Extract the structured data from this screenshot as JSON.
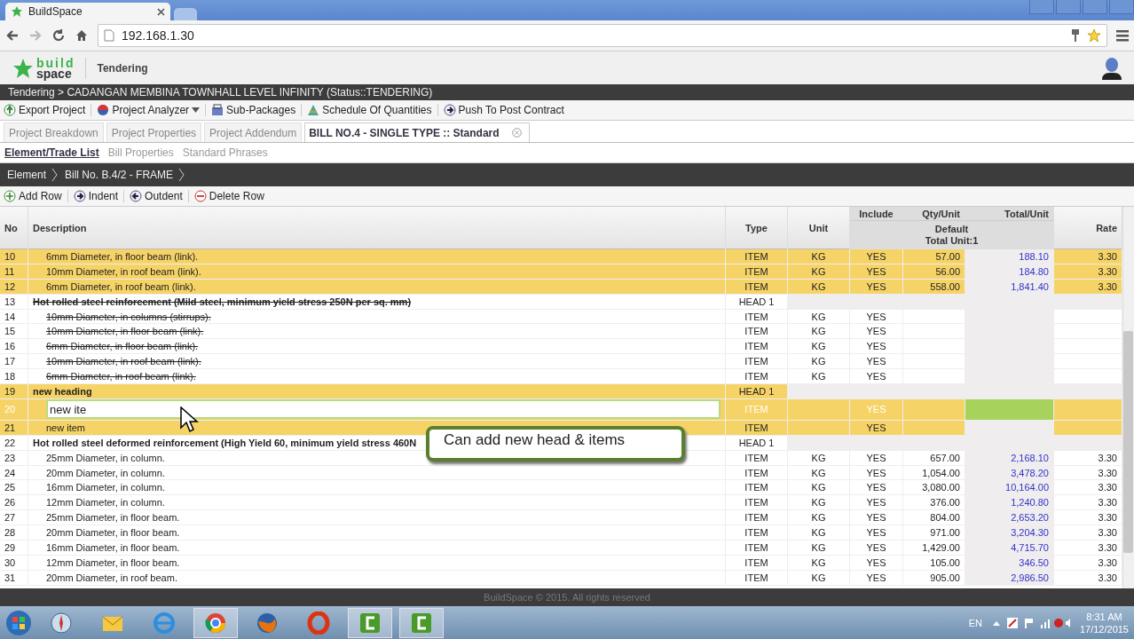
{
  "browser": {
    "tabs": [
      {
        "title": "BuildSpace",
        "selected": true
      },
      {
        "selected": false
      }
    ],
    "address": "192.168.1.30"
  },
  "app": {
    "logo_top": "build",
    "logo_bottom": "space",
    "module": "Tendering"
  },
  "breadcrumb": "Tendering > CADANGAN MEMBINA TOWNHALL LEVEL INFINITY (Status::TENDERING)",
  "toolbar": [
    {
      "label": "Export Project",
      "kind": "button"
    },
    {
      "label": "Project Analyzer",
      "kind": "menu"
    },
    {
      "label": "Sub-Packages",
      "kind": "button"
    },
    {
      "label": "Schedule Of Quantities",
      "kind": "button"
    },
    {
      "label": "Push To Post Contract",
      "kind": "button"
    }
  ],
  "tabs": [
    {
      "label": "Project Breakdown",
      "selected": false,
      "kind": "fixed"
    },
    {
      "label": "Project Properties",
      "selected": false,
      "kind": "fixed"
    },
    {
      "label": "Project Addendum",
      "selected": false,
      "kind": "fixed"
    },
    {
      "label": "BILL NO.4 - SINGLE TYPE :: Standard",
      "selected": true,
      "kind": "closable"
    }
  ],
  "subtabs": [
    {
      "label": "Element/Trade List",
      "selected": true
    },
    {
      "label": "Bill Properties",
      "selected": false
    },
    {
      "label": "Standard Phrases",
      "selected": false
    }
  ],
  "path": [
    "Element",
    "Bill No. B.4/2 - FRAME"
  ],
  "row_actions": [
    {
      "label": "Add Row"
    },
    {
      "label": "Indent"
    },
    {
      "label": "Outdent"
    },
    {
      "label": "Delete Row"
    }
  ],
  "table": {
    "columns": {
      "no": "No",
      "description": "Description",
      "type": "Type",
      "unit": "Unit",
      "include": "Include",
      "qty": "Qty/Unit",
      "total": "Total/Unit",
      "rate": "Rate",
      "group": "Default",
      "group_sub": "Total Unit:1"
    },
    "rows": [
      {
        "no": "10",
        "description": "6mm Diameter, in floor beam (link).",
        "kind": "item",
        "type": "ITEM",
        "unit": "KG",
        "include": "YES",
        "qty": "57.00",
        "total": "188.10",
        "rate": "3.30",
        "selected": true,
        "deleted": false
      },
      {
        "no": "11",
        "description": "10mm Diameter, in roof beam (link).",
        "kind": "item",
        "type": "ITEM",
        "unit": "KG",
        "include": "YES",
        "qty": "56.00",
        "total": "184.80",
        "rate": "3.30",
        "selected": true,
        "deleted": false
      },
      {
        "no": "12",
        "description": "6mm Diameter, in roof beam (link).",
        "kind": "item",
        "type": "ITEM",
        "unit": "KG",
        "include": "YES",
        "qty": "558.00",
        "total": "1,841.40",
        "rate": "3.30",
        "selected": true,
        "deleted": false
      },
      {
        "no": "13",
        "description": "Hot rolled steel reinforcement (Mild steel, minimum yield stress 250N per sq. mm)",
        "kind": "head",
        "type": "HEAD 1",
        "selected": false,
        "deleted": true
      },
      {
        "no": "14",
        "description": "10mm Diameter, in columns (stirrups).",
        "kind": "item",
        "type": "ITEM",
        "unit": "KG",
        "include": "YES",
        "selected": false,
        "deleted": true
      },
      {
        "no": "15",
        "description": "10mm Diameter, in floor beam (link).",
        "kind": "item",
        "type": "ITEM",
        "unit": "KG",
        "include": "YES",
        "selected": false,
        "deleted": true
      },
      {
        "no": "16",
        "description": "6mm Diameter, in floor beam (link).",
        "kind": "item",
        "type": "ITEM",
        "unit": "KG",
        "include": "YES",
        "selected": false,
        "deleted": true
      },
      {
        "no": "17",
        "description": "10mm Diameter, in roof beam (link).",
        "kind": "item",
        "type": "ITEM",
        "unit": "KG",
        "include": "YES",
        "selected": false,
        "deleted": true
      },
      {
        "no": "18",
        "description": "6mm Diameter, in roof beam (link).",
        "kind": "item",
        "type": "ITEM",
        "unit": "KG",
        "include": "YES",
        "selected": false,
        "deleted": true
      },
      {
        "no": "19",
        "description": "new heading",
        "kind": "head",
        "type": "HEAD 1",
        "selected": true,
        "deleted": false
      },
      {
        "no": "20",
        "description": "new ite",
        "kind": "item",
        "type": "ITEM",
        "include": "YES",
        "selected": true,
        "deleted": false,
        "editing": true
      },
      {
        "no": "21",
        "description": "new item",
        "kind": "item",
        "type": "ITEM",
        "include": "YES",
        "selected": true,
        "deleted": false
      },
      {
        "no": "22",
        "description": "Hot rolled steel deformed reinforcement (High Yield 60, minimum yield stress 460N",
        "kind": "head",
        "type": "HEAD 1",
        "selected": false,
        "deleted": false
      },
      {
        "no": "23",
        "description": "25mm Diameter, in column.",
        "kind": "item",
        "type": "ITEM",
        "unit": "KG",
        "include": "YES",
        "qty": "657.00",
        "total": "2,168.10",
        "rate": "3.30",
        "selected": false,
        "deleted": false
      },
      {
        "no": "24",
        "description": "20mm Diameter, in column.",
        "kind": "item",
        "type": "ITEM",
        "unit": "KG",
        "include": "YES",
        "qty": "1,054.00",
        "total": "3,478.20",
        "rate": "3.30",
        "selected": false,
        "deleted": false
      },
      {
        "no": "25",
        "description": "16mm Diameter, in column.",
        "kind": "item",
        "type": "ITEM",
        "unit": "KG",
        "include": "YES",
        "qty": "3,080.00",
        "total": "10,164.00",
        "rate": "3.30",
        "selected": false,
        "deleted": false
      },
      {
        "no": "26",
        "description": "12mm Diameter, in column.",
        "kind": "item",
        "type": "ITEM",
        "unit": "KG",
        "include": "YES",
        "qty": "376.00",
        "total": "1,240.80",
        "rate": "3.30",
        "selected": false,
        "deleted": false
      },
      {
        "no": "27",
        "description": "25mm Diameter, in floor beam.",
        "kind": "item",
        "type": "ITEM",
        "unit": "KG",
        "include": "YES",
        "qty": "804.00",
        "total": "2,653.20",
        "rate": "3.30",
        "selected": false,
        "deleted": false
      },
      {
        "no": "28",
        "description": "20mm Diameter, in floor beam.",
        "kind": "item",
        "type": "ITEM",
        "unit": "KG",
        "include": "YES",
        "qty": "971.00",
        "total": "3,204.30",
        "rate": "3.30",
        "selected": false,
        "deleted": false
      },
      {
        "no": "29",
        "description": "16mm Diameter, in floor beam.",
        "kind": "item",
        "type": "ITEM",
        "unit": "KG",
        "include": "YES",
        "qty": "1,429.00",
        "total": "4,715.70",
        "rate": "3.30",
        "selected": false,
        "deleted": false
      },
      {
        "no": "30",
        "description": "12mm Diameter, in floor beam.",
        "kind": "item",
        "type": "ITEM",
        "unit": "KG",
        "include": "YES",
        "qty": "105.00",
        "total": "346.50",
        "rate": "3.30",
        "selected": false,
        "deleted": false
      },
      {
        "no": "31",
        "description": "20mm Diameter, in roof beam.",
        "kind": "item",
        "type": "ITEM",
        "unit": "KG",
        "include": "YES",
        "qty": "905.00",
        "total": "2,986.50",
        "rate": "3.30",
        "selected": false,
        "deleted": false
      }
    ]
  },
  "callout": "Can add new head & items",
  "footer": "BuildSpace © 2015. All rights reserved",
  "taskbar": {
    "apps": [
      {
        "kind": "safari",
        "active": false
      },
      {
        "kind": "mail",
        "active": false
      },
      {
        "kind": "ie",
        "active": false
      },
      {
        "kind": "chrome",
        "active": true
      },
      {
        "kind": "firefox",
        "active": false
      },
      {
        "kind": "opera",
        "active": false
      },
      {
        "kind": "camtasia",
        "active": true
      },
      {
        "kind": "camtasia",
        "active": true
      }
    ],
    "language": "EN",
    "time": "8:31 AM",
    "date": "17/12/2015"
  }
}
